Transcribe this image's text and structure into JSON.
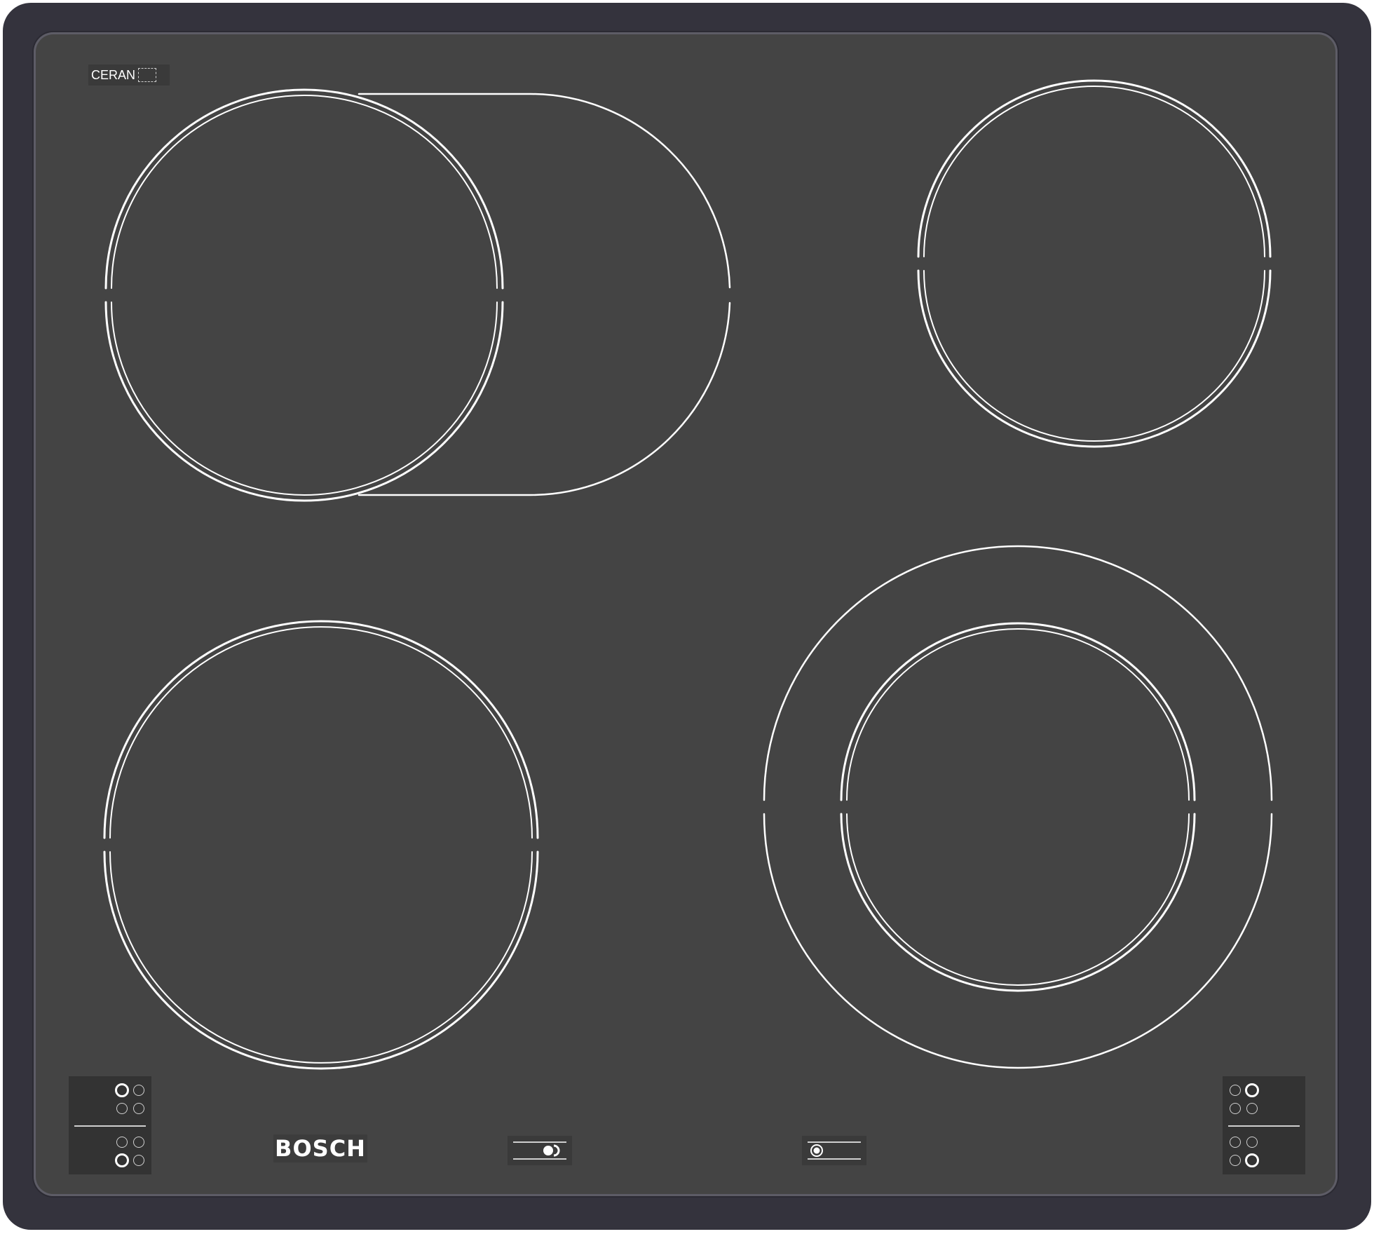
{
  "brand": {
    "logo_text": "BOSCH",
    "material_label": "CERAN"
  },
  "colors": {
    "frame": "#34333d",
    "glass": "#444444",
    "markings": "#ffffff"
  },
  "cooking_zones": [
    {
      "id": "front-left-extended",
      "type": "dual-extended-oval"
    },
    {
      "id": "rear-right",
      "type": "single-circle"
    },
    {
      "id": "front-left",
      "type": "single-circle"
    },
    {
      "id": "front-right",
      "type": "dual-concentric"
    }
  ],
  "controls": {
    "zone_indicator_panels": [
      {
        "id": "left-panel",
        "position": "bottom-left"
      },
      {
        "id": "right-panel",
        "position": "bottom-right"
      }
    ],
    "extension_keys": [
      {
        "id": "oval-extension-key",
        "icon": "dual-zone-icon"
      },
      {
        "id": "concentric-extension-key",
        "icon": "ring-zone-icon"
      }
    ]
  }
}
